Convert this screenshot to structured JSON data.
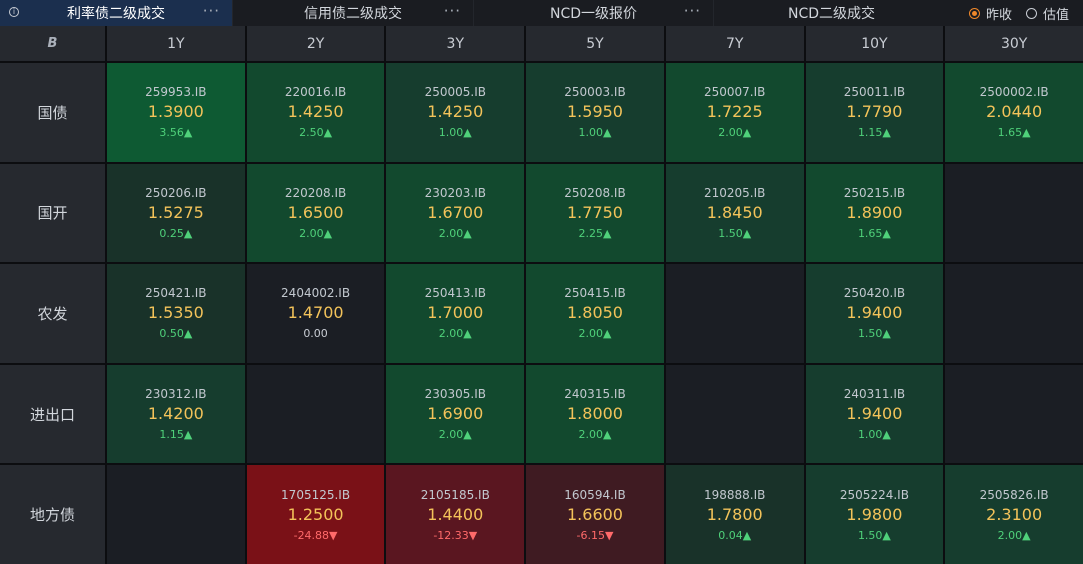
{
  "tabs": [
    {
      "label": "利率债二级成交",
      "active": true
    },
    {
      "label": "信用债二级成交",
      "active": false
    },
    {
      "label": "NCD一级报价",
      "active": false
    },
    {
      "label": "NCD二级成交",
      "active": false
    }
  ],
  "tab_menu_label": "···",
  "info_label": "i",
  "corner_icon": "B",
  "radio": {
    "prev_close": "昨收",
    "valuation": "估值",
    "selected": "prev_close"
  },
  "columns": [
    "1Y",
    "2Y",
    "3Y",
    "5Y",
    "7Y",
    "10Y",
    "30Y"
  ],
  "colors": {
    "green_strong": "#0e5a33",
    "green_med": "#12492e",
    "green_dark": "#163d2e",
    "green_darker": "#193229",
    "neutral": "#1b1e24",
    "red_strong": "#7a1117",
    "red_med": "#5a1620",
    "red_dark": "#3f1b22",
    "value_yellow": "#f3c35a",
    "up_green": "#4fd17a",
    "down_red": "#ff6a6a",
    "radio_accent": "#f0882a"
  },
  "rows": [
    {
      "label": "国债",
      "cells": [
        {
          "code": "259953.IB",
          "value": "1.3900",
          "change": "3.56▲",
          "dir": "up",
          "shade": "green_strong"
        },
        {
          "code": "220016.IB",
          "value": "1.4250",
          "change": "2.50▲",
          "dir": "up",
          "shade": "green_med"
        },
        {
          "code": "250005.IB",
          "value": "1.4250",
          "change": "1.00▲",
          "dir": "up",
          "shade": "green_dark"
        },
        {
          "code": "250003.IB",
          "value": "1.5950",
          "change": "1.00▲",
          "dir": "up",
          "shade": "green_dark"
        },
        {
          "code": "250007.IB",
          "value": "1.7225",
          "change": "2.00▲",
          "dir": "up",
          "shade": "green_med"
        },
        {
          "code": "250011.IB",
          "value": "1.7790",
          "change": "1.15▲",
          "dir": "up",
          "shade": "green_dark"
        },
        {
          "code": "2500002.IB",
          "value": "2.0440",
          "change": "1.65▲",
          "dir": "up",
          "shade": "green_med"
        }
      ]
    },
    {
      "label": "国开",
      "cells": [
        {
          "code": "250206.IB",
          "value": "1.5275",
          "change": "0.25▲",
          "dir": "up",
          "shade": "green_darker"
        },
        {
          "code": "220208.IB",
          "value": "1.6500",
          "change": "2.00▲",
          "dir": "up",
          "shade": "green_med"
        },
        {
          "code": "230203.IB",
          "value": "1.6700",
          "change": "2.00▲",
          "dir": "up",
          "shade": "green_med"
        },
        {
          "code": "250208.IB",
          "value": "1.7750",
          "change": "2.25▲",
          "dir": "up",
          "shade": "green_med"
        },
        {
          "code": "210205.IB",
          "value": "1.8450",
          "change": "1.50▲",
          "dir": "up",
          "shade": "green_dark"
        },
        {
          "code": "250215.IB",
          "value": "1.8900",
          "change": "1.65▲",
          "dir": "up",
          "shade": "green_med"
        },
        null
      ]
    },
    {
      "label": "农发",
      "cells": [
        {
          "code": "250421.IB",
          "value": "1.5350",
          "change": "0.50▲",
          "dir": "up",
          "shade": "green_darker"
        },
        {
          "code": "2404002.IB",
          "value": "1.4700",
          "change": "0.00",
          "dir": "flat",
          "shade": "neutral"
        },
        {
          "code": "250413.IB",
          "value": "1.7000",
          "change": "2.00▲",
          "dir": "up",
          "shade": "green_med"
        },
        {
          "code": "250415.IB",
          "value": "1.8050",
          "change": "2.00▲",
          "dir": "up",
          "shade": "green_med"
        },
        null,
        {
          "code": "250420.IB",
          "value": "1.9400",
          "change": "1.50▲",
          "dir": "up",
          "shade": "green_dark"
        },
        null
      ]
    },
    {
      "label": "进出口",
      "cells": [
        {
          "code": "230312.IB",
          "value": "1.4200",
          "change": "1.15▲",
          "dir": "up",
          "shade": "green_dark"
        },
        null,
        {
          "code": "230305.IB",
          "value": "1.6900",
          "change": "2.00▲",
          "dir": "up",
          "shade": "green_med"
        },
        {
          "code": "240315.IB",
          "value": "1.8000",
          "change": "2.00▲",
          "dir": "up",
          "shade": "green_med"
        },
        null,
        {
          "code": "240311.IB",
          "value": "1.9400",
          "change": "1.00▲",
          "dir": "up",
          "shade": "green_dark"
        },
        null
      ]
    },
    {
      "label": "地方债",
      "cells": [
        null,
        {
          "code": "1705125.IB",
          "value": "1.2500",
          "change": "-24.88▼",
          "dir": "down",
          "shade": "red_strong"
        },
        {
          "code": "2105185.IB",
          "value": "1.4400",
          "change": "-12.33▼",
          "dir": "down",
          "shade": "red_med"
        },
        {
          "code": "160594.IB",
          "value": "1.6600",
          "change": "-6.15▼",
          "dir": "down",
          "shade": "red_dark"
        },
        {
          "code": "198888.IB",
          "value": "1.7800",
          "change": "0.04▲",
          "dir": "up",
          "shade": "green_darker"
        },
        {
          "code": "2505224.IB",
          "value": "1.9800",
          "change": "1.50▲",
          "dir": "up",
          "shade": "green_dark"
        },
        {
          "code": "2505826.IB",
          "value": "2.3100",
          "change": "2.00▲",
          "dir": "up",
          "shade": "green_dark"
        }
      ]
    }
  ]
}
